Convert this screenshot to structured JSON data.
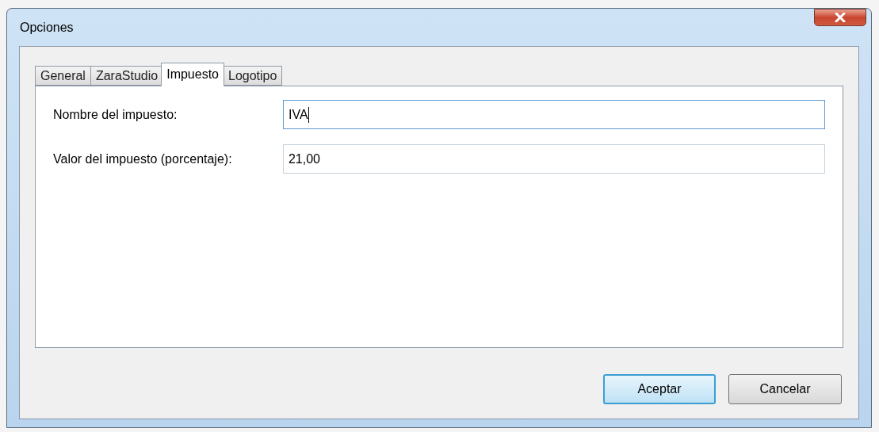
{
  "window": {
    "title": "Opciones"
  },
  "tabs": [
    {
      "label": "General",
      "selected": false
    },
    {
      "label": "ZaraStudio",
      "selected": false
    },
    {
      "label": "Impuesto",
      "selected": true
    },
    {
      "label": "Logotipo",
      "selected": false
    }
  ],
  "fields": [
    {
      "label": "Nombre del impuesto:",
      "value": "IVA",
      "focused": true
    },
    {
      "label": "Valor del impuesto (porcentaje):",
      "value": "21,00",
      "focused": false
    }
  ],
  "buttons": [
    {
      "label": "Aceptar",
      "default": true
    },
    {
      "label": "Cancelar",
      "default": false
    }
  ]
}
